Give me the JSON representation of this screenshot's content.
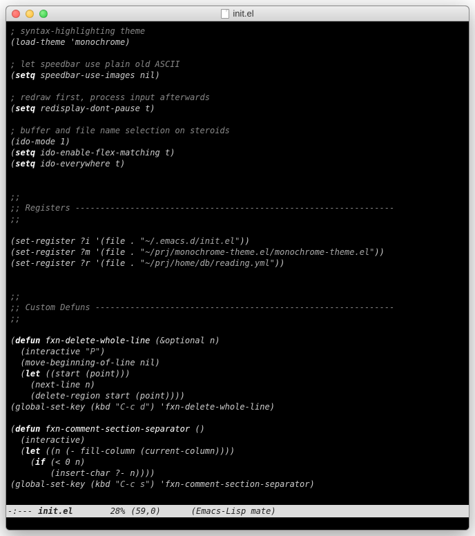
{
  "window": {
    "title": "init.el"
  },
  "code": {
    "l01_c": "; syntax-highlighting theme",
    "l02_a": "(load-theme ",
    "l02_b": "'monochrome",
    "l02_c": ")",
    "l04_c": "; let speedbar use plain old ASCII",
    "l05_a": "(",
    "l05_kw": "setq",
    "l05_b": " speedbar-use-images nil)",
    "l07_c": "; redraw first, process input afterwards",
    "l08_a": "(",
    "l08_kw": "setq",
    "l08_b": " redisplay-dont-pause t)",
    "l10_c": "; buffer and file name selection on steroids",
    "l11": "(ido-mode 1)",
    "l12_a": "(",
    "l12_kw": "setq",
    "l12_b": " ido-enable-flex-matching t)",
    "l13_a": "(",
    "l13_kw": "setq",
    "l13_b": " ido-everywhere t)",
    "l16": ";;",
    "l17": ";; Registers ----------------------------------------------------------------",
    "l18": ";;",
    "l20_a": "(set-register ?i '(file . ",
    "l20_s": "\"~/.emacs.d/init.el\"",
    "l20_b": "))",
    "l21_a": "(set-register ?m '(file . ",
    "l21_s": "\"~/prj/monochrome-theme.el/monochrome-theme.el\"",
    "l21_b": "))",
    "l22_a": "(set-register ?r '(file . ",
    "l22_s": "\"~/prj/home/db/reading.yml\"",
    "l22_b": "))",
    "l25": ";;",
    "l26": ";; Custom Defuns ------------------------------------------------------------",
    "l27": ";;",
    "l29_a": "(",
    "l29_kw": "defun",
    "l29_b": " ",
    "l29_fn": "fxn-delete-whole-line",
    "l29_c": " (",
    "l29_opt": "&optional",
    "l29_d": " n)",
    "l30_a": "  (interactive ",
    "l30_s": "\"P\"",
    "l30_b": ")",
    "l31": "  (move-beginning-of-line nil)",
    "l32_a": "  (",
    "l32_kw": "let",
    "l32_b": " ((start (point)))",
    "l33": "    (next-line n)",
    "l34": "    (delete-region start (point))))",
    "l35_a": "(global-set-key (kbd ",
    "l35_s": "\"C-c d\"",
    "l35_b": ") 'fxn-delete-whole-line)",
    "l37_a": "(",
    "l37_kw": "defun",
    "l37_b": " ",
    "l37_fn": "fxn-comment-section-separator",
    "l37_c": " ()",
    "l38": "  (interactive)",
    "l39_a": "  (",
    "l39_kw": "let",
    "l39_b": " ((n (- fill-column (current-column))))",
    "l40_a": "    (",
    "l40_kw": "if",
    "l40_b": " (< 0 n)",
    "l41": "        (insert-char ?- n))))",
    "l42_a": "(global-set-key (kbd ",
    "l42_s": "\"C-c s\"",
    "l42_b": ") 'fxn-comment-section-separator)"
  },
  "modeline": {
    "status": "-:---",
    "file": "init.el",
    "percent": "28%",
    "position": "(59,0)",
    "mode": "(Emacs-Lisp mate)"
  },
  "minibuffer": ""
}
